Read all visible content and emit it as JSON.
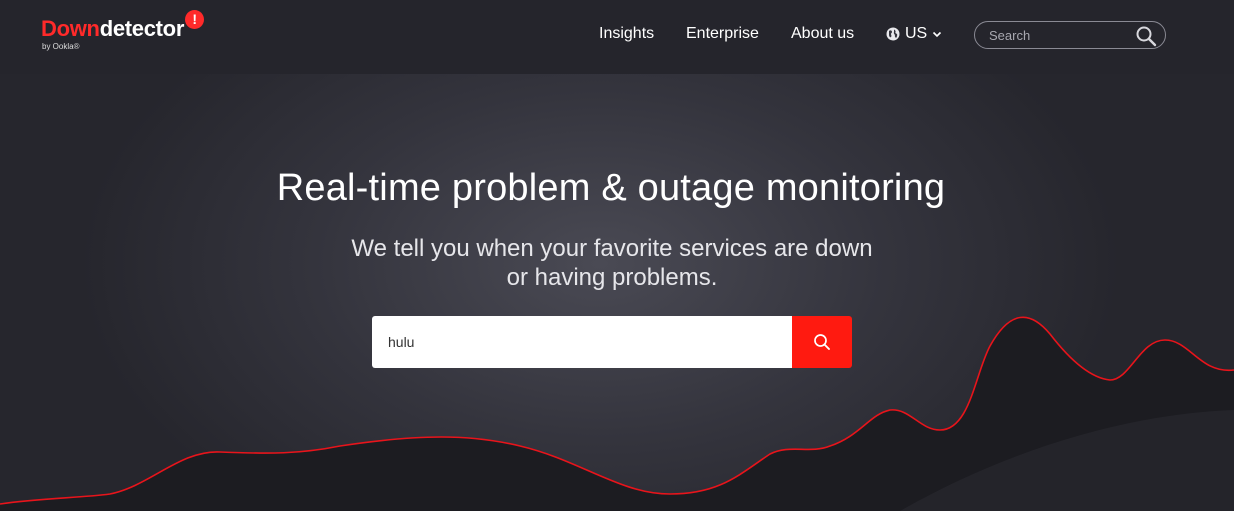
{
  "brand": {
    "name_part1": "Down",
    "name_part2": "detector",
    "badge": "!",
    "byline": "by Ookla®"
  },
  "nav": {
    "items": [
      {
        "label": "Insights"
      },
      {
        "label": "Enterprise"
      },
      {
        "label": "About us"
      }
    ],
    "locale": {
      "label": "US",
      "icon": "globe-icon"
    }
  },
  "header_search": {
    "placeholder": "Search",
    "icon": "search-icon"
  },
  "hero": {
    "title": "Real-time problem & outage monitoring",
    "subtitle_line1": "We tell you when your favorite services are down",
    "subtitle_line2": "or having problems.",
    "search": {
      "value": "hulu",
      "button_icon": "search-icon"
    }
  },
  "colors": {
    "accent": "#ff1a10",
    "header_bg": "#25252c",
    "hero_bg": "#34343d"
  }
}
